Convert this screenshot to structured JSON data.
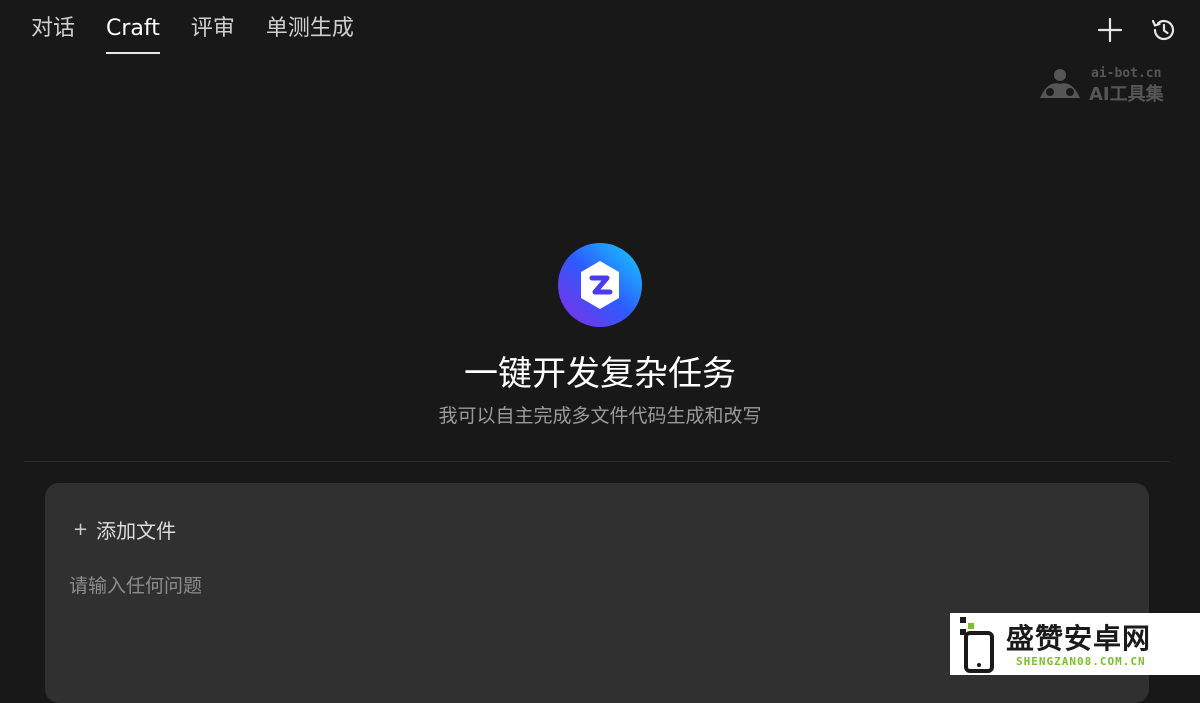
{
  "tabs": [
    {
      "label": "对话",
      "active": false
    },
    {
      "label": "Craft",
      "active": true
    },
    {
      "label": "评审",
      "active": false
    },
    {
      "label": "单测生成",
      "active": false
    }
  ],
  "toolbar": {
    "new_icon": "plus-icon",
    "history_icon": "history-icon"
  },
  "watermark_top": {
    "line1": "ai-bot.cn",
    "line2": "AI工具集"
  },
  "hero": {
    "title": "一键开发复杂任务",
    "subtitle": "我可以自主完成多文件代码生成和改写",
    "logo_colors": [
      "#7b2ff7",
      "#1e88e5",
      "#00c6ff",
      "#c026d3"
    ]
  },
  "composer": {
    "add_file_label": "添加文件",
    "add_file_icon": "+",
    "placeholder": "请输入任何问题",
    "value": ""
  },
  "watermark_bottom": {
    "brand": "盛赞安卓网",
    "url": "SHENGZAN08.COM.CN"
  }
}
